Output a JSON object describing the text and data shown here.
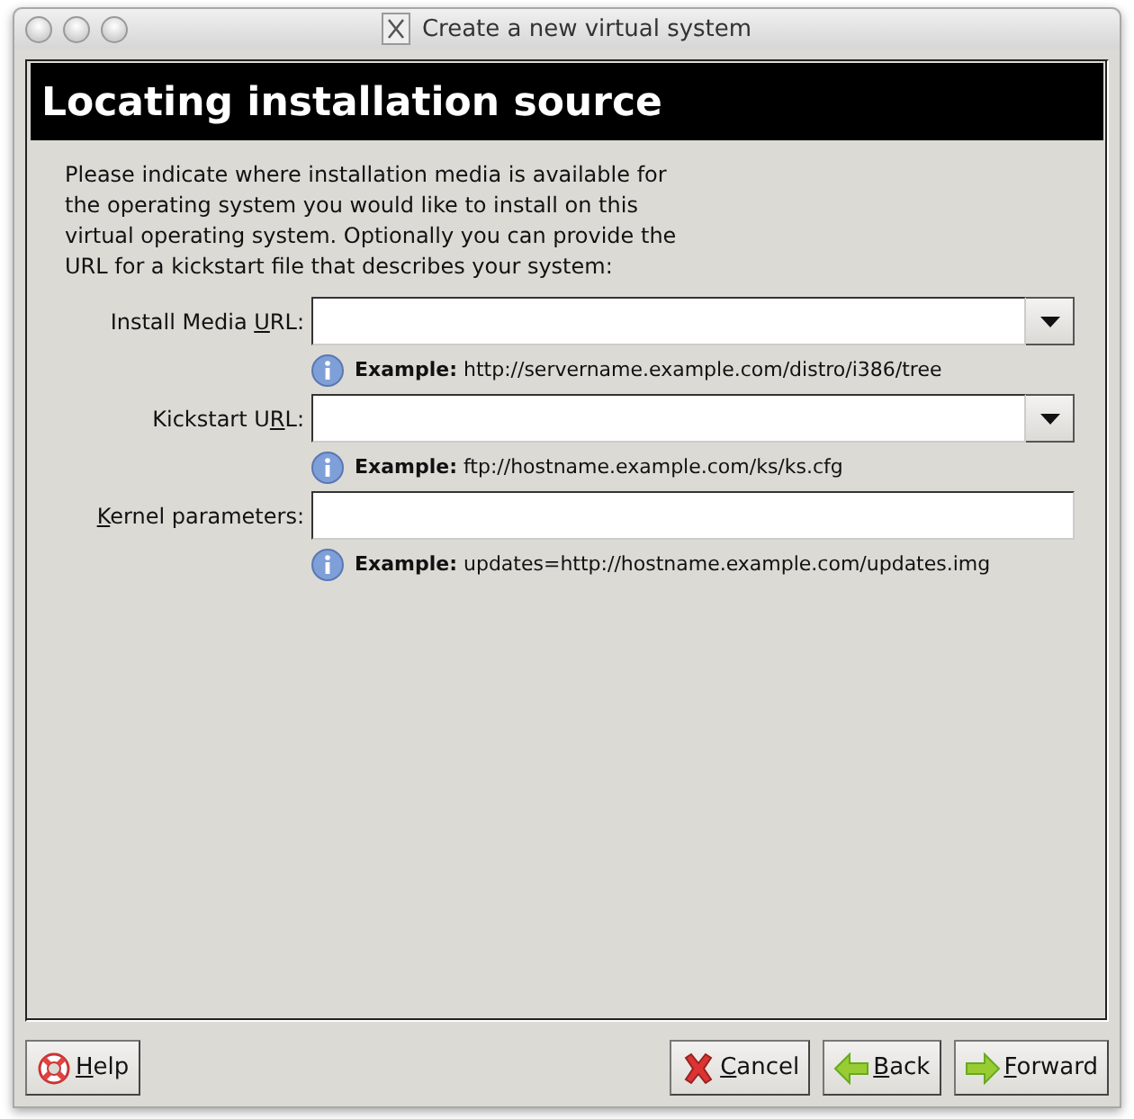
{
  "window": {
    "title": "Create a new virtual system"
  },
  "header": "Locating installation source",
  "intro": "Please indicate where installation media is available for the operating system you would like to install on this virtual operating system. Optionally you can provide the URL for a kickstart file that describes your system:",
  "fields": [
    {
      "kind": "combo",
      "label": {
        "before": "Install Media ",
        "key": "U",
        "after": "RL:"
      },
      "hint_bold": "Example:",
      "hint": "http://servername.example.com/distro/i386/tree"
    },
    {
      "kind": "combo",
      "label": {
        "before": "Kickstart U",
        "key": "R",
        "after": "L:"
      },
      "hint_bold": "Example:",
      "hint": "ftp://hostname.example.com/ks/ks.cfg"
    },
    {
      "kind": "entry",
      "label": {
        "key": "K",
        "after": "ernel parameters:"
      },
      "hint_bold": "Example:",
      "hint": "updates=http://hostname.example.com/updates.img"
    }
  ],
  "buttons": [
    {
      "kind": "help",
      "label": {
        "key": "H",
        "after": "elp"
      }
    },
    {
      "kind": "cancel",
      "label": {
        "key": "C",
        "after": "ancel"
      }
    },
    {
      "kind": "back",
      "label": {
        "key": "B",
        "after": "ack"
      }
    },
    {
      "kind": "forward",
      "label": {
        "key": "F",
        "after": "orward"
      }
    }
  ]
}
